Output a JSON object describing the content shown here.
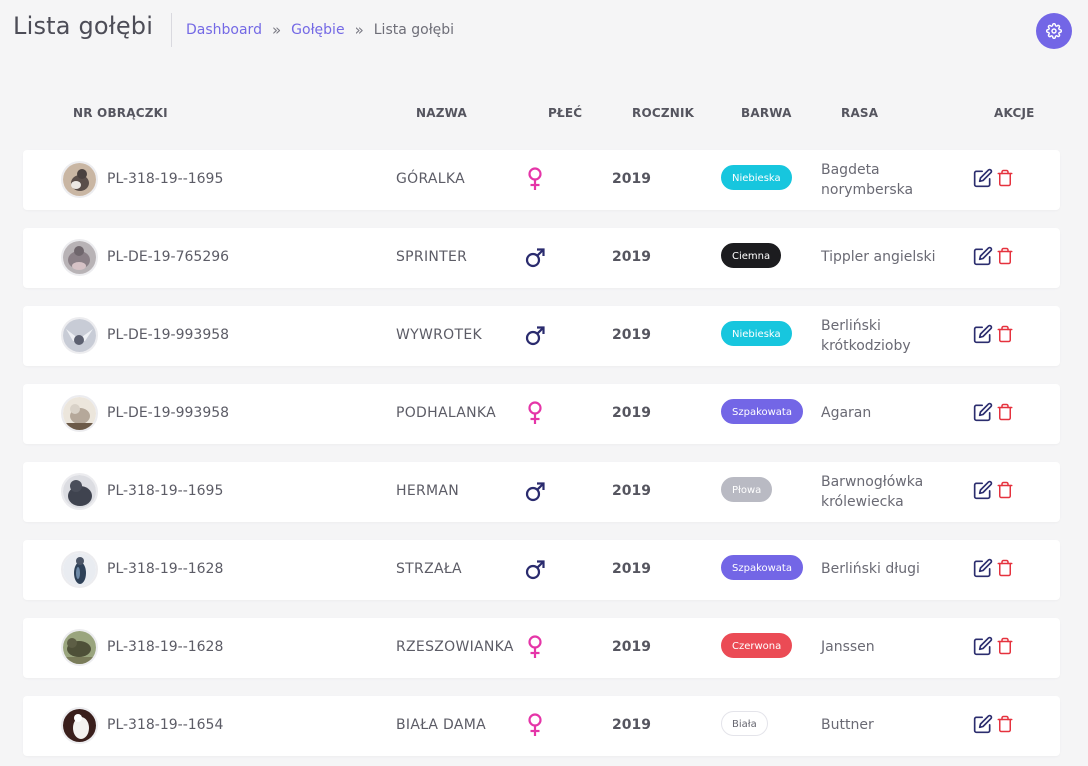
{
  "header": {
    "title": "Lista gołębi",
    "breadcrumb": {
      "items": [
        "Dashboard",
        "Gołębie"
      ],
      "separator": "»",
      "current": "Lista gołębi"
    }
  },
  "table": {
    "columns": {
      "ring": "NR OBRĄCZKI",
      "name": "NAZWA",
      "sex": "PŁEĆ",
      "year": "ROCZNIK",
      "color": "BARWA",
      "breed": "RASA",
      "actions": "AKCJE"
    },
    "rows": [
      {
        "ring": "PL-318-19--1695",
        "name": "GÓRALKA",
        "sex": "female",
        "year": "2019",
        "color": "Niebieska",
        "breed_lines": [
          "Bagdeta",
          "norymberska"
        ]
      },
      {
        "ring": "PL-DE-19-765296",
        "name": "SPRINTER",
        "sex": "male",
        "year": "2019",
        "color": "Ciemna",
        "breed_lines": [
          "Tippler angielski"
        ]
      },
      {
        "ring": "PL-DE-19-993958",
        "name": "WYWROTEK",
        "sex": "male",
        "year": "2019",
        "color": "Niebieska",
        "breed_lines": [
          "Berliński",
          "krótkodzioby"
        ]
      },
      {
        "ring": "PL-DE-19-993958",
        "name": "PODHALANKA",
        "sex": "female",
        "year": "2019",
        "color": "Szpakowata",
        "breed_lines": [
          "Agaran"
        ]
      },
      {
        "ring": "PL-318-19--1695",
        "name": "HERMAN",
        "sex": "male",
        "year": "2019",
        "color": "Płowa",
        "breed_lines": [
          "Barwnogłówka",
          "królewiecka"
        ]
      },
      {
        "ring": "PL-318-19--1628",
        "name": "STRZAŁA",
        "sex": "male",
        "year": "2019",
        "color": "Szpakowata",
        "breed_lines": [
          "Berliński długi"
        ]
      },
      {
        "ring": "PL-318-19--1628",
        "name": "RZESZOWIANKA",
        "sex": "female",
        "year": "2019",
        "color": "Czerwona",
        "breed_lines": [
          "Janssen"
        ]
      },
      {
        "ring": "PL-318-19--1654",
        "name": "BIAŁA DAMA",
        "sex": "female",
        "year": "2019",
        "color": "Biała",
        "breed_lines": [
          "Buttner"
        ]
      }
    ]
  },
  "badge_styles": {
    "Niebieska": {
      "bg": "#17c6de",
      "fg": "#ffffff",
      "border": "#17c6de"
    },
    "Ciemna": {
      "bg": "#1c1c1f",
      "fg": "#ffffff",
      "border": "#1c1c1f"
    },
    "Szpakowata": {
      "bg": "#7366e6",
      "fg": "#ffffff",
      "border": "#7366e6"
    },
    "Płowa": {
      "bg": "#b9bac3",
      "fg": "#ffffff",
      "border": "#b9bac3"
    },
    "Czerwona": {
      "bg": "#eb4b55",
      "fg": "#ffffff",
      "border": "#eb4b55"
    },
    "Biała": {
      "bg": "#ffffff",
      "fg": "#666670",
      "border": "#e4e4ea"
    }
  },
  "colors": {
    "accent": "#7366e6",
    "female": "#e535a8",
    "male": "#2a2b6e",
    "edit_icon": "#2b2d6e",
    "delete_icon": "#e5323e"
  },
  "icons": {
    "settings": "gear-icon",
    "female": "female-symbol-icon",
    "male": "male-symbol-icon",
    "edit": "edit-icon",
    "delete": "trash-icon",
    "avatar": "pigeon-photo"
  }
}
